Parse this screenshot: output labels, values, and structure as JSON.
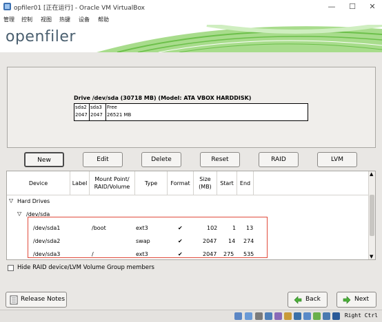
{
  "window": {
    "title": "opfiler01 [正在运行] - Oracle VM VirtualBox",
    "minimize": "—",
    "maximize": "☐",
    "close": "✕"
  },
  "menu": [
    "管理",
    "控制",
    "视图",
    "热键",
    "设备",
    "帮助"
  ],
  "logo": "openfiler",
  "disk": {
    "label": "Drive /dev/sda (30718 MB) (Model: ATA VBOX HARDDISK)",
    "segments": [
      {
        "name": "sda2",
        "size": "2047"
      },
      {
        "name": "sda3",
        "size": "2047"
      },
      {
        "name": "Free",
        "size": "26521 MB"
      }
    ]
  },
  "buttons": {
    "new": "New",
    "edit": "Edit",
    "delete": "Delete",
    "reset": "Reset",
    "raid": "RAID",
    "lvm": "LVM"
  },
  "table": {
    "headers": {
      "device": "Device",
      "label": "Label",
      "mount": "Mount Point/\nRAID/Volume",
      "type": "Type",
      "format": "Format",
      "size": "Size\n(MB)",
      "start": "Start",
      "end": "End"
    },
    "group": "Hard Drives",
    "disk": "/dev/sda",
    "check": "✔",
    "rows": [
      {
        "device": "/dev/sda1",
        "mount": "/boot",
        "type": "ext3",
        "size": "102",
        "start": "1",
        "end": "13"
      },
      {
        "device": "/dev/sda2",
        "mount": "",
        "type": "swap",
        "size": "2047",
        "start": "14",
        "end": "274"
      },
      {
        "device": "/dev/sda3",
        "mount": "/",
        "type": "ext3",
        "size": "2047",
        "start": "275",
        "end": "535"
      }
    ]
  },
  "hide_raid_label": "Hide RAID device/LVM Volume Group members",
  "release_notes": "Release Notes",
  "back": "Back",
  "next": "Next",
  "host_key": "Right Ctrl",
  "colors": {
    "accent_green": "#6cc04a",
    "highlight_red": "#e04a3a",
    "logo_blue": "#4a5f6f"
  }
}
